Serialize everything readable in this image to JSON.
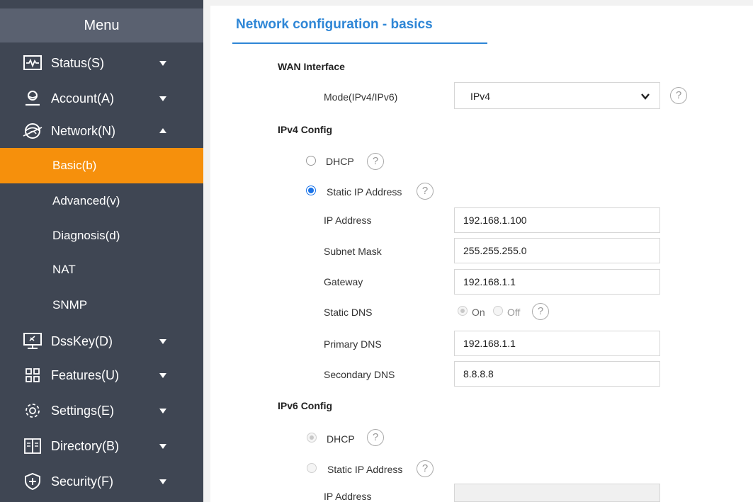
{
  "sidebar": {
    "title": "Menu",
    "items": [
      {
        "label": "Status(S)",
        "icon": "status-icon",
        "caret": "down"
      },
      {
        "label": "Account(A)",
        "icon": "account-icon",
        "caret": "down"
      },
      {
        "label": "Network(N)",
        "icon": "network-icon",
        "caret": "up"
      },
      {
        "label": "DssKey(D)",
        "icon": "dsskey-icon",
        "caret": "down"
      },
      {
        "label": "Features(U)",
        "icon": "features-icon",
        "caret": "down"
      },
      {
        "label": "Settings(E)",
        "icon": "settings-icon",
        "caret": "down"
      },
      {
        "label": "Directory(B)",
        "icon": "directory-icon",
        "caret": "down"
      },
      {
        "label": "Security(F)",
        "icon": "security-icon",
        "caret": "down"
      }
    ],
    "network_sub": [
      {
        "label": "Basic(b)",
        "active": true
      },
      {
        "label": "Advanced(v)",
        "active": false
      },
      {
        "label": "Diagnosis(d)",
        "active": false
      },
      {
        "label": "NAT",
        "active": false
      },
      {
        "label": "SNMP",
        "active": false
      }
    ],
    "colors": {
      "background": "#3f4653",
      "header": "#5a6170",
      "active": "#f6900c"
    }
  },
  "main": {
    "title": "Network configuration - basics",
    "title_color": "#2e86d6",
    "wan": {
      "section_title": "WAN Interface",
      "mode_label": "Mode(IPv4/IPv6)",
      "mode_value": "IPv4",
      "help": "?"
    },
    "ipv4": {
      "section_title": "IPv4 Config",
      "dhcp_label": "DHCP",
      "static_label": "Static IP Address",
      "selected": "static",
      "ip_label": "IP Address",
      "ip_value": "192.168.1.100",
      "mask_label": "Subnet Mask",
      "mask_value": "255.255.255.0",
      "gateway_label": "Gateway",
      "gateway_value": "192.168.1.1",
      "static_dns_label": "Static DNS",
      "static_dns_on": "On",
      "static_dns_off": "Off",
      "primary_dns_label": "Primary DNS",
      "primary_dns_value": "192.168.1.1",
      "secondary_dns_label": "Secondary DNS",
      "secondary_dns_value": "8.8.8.8",
      "help": "?"
    },
    "ipv6": {
      "section_title": "IPv6 Config",
      "dhcp_label": "DHCP",
      "static_label": "Static IP Address",
      "ip_label": "IP Address",
      "ip_value": "",
      "help": "?"
    }
  }
}
